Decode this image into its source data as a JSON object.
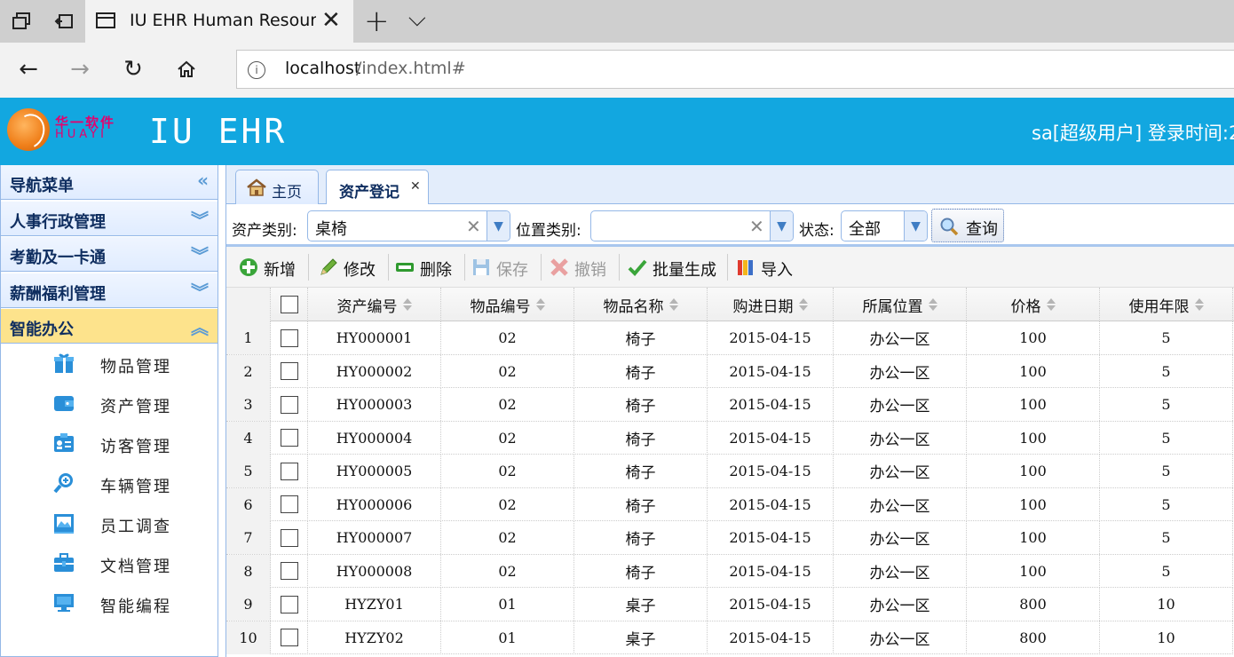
{
  "browser": {
    "tab_title": "IU EHR Human Resource",
    "address_host": "localhost",
    "address_path": "/index.html#"
  },
  "header": {
    "logo_cn": "华一软件",
    "logo_en": "HUAYI",
    "app_title": "IU EHR",
    "user_info": "sa[超级用户] 登录时间:2"
  },
  "sidebar": {
    "nav_title": "导航菜单",
    "sections": [
      {
        "label": "人事行政管理"
      },
      {
        "label": "考勤及一卡通"
      },
      {
        "label": "薪酬福利管理"
      },
      {
        "label": "智能办公"
      }
    ],
    "items": [
      {
        "label": "物品管理",
        "icon": "gift-icon"
      },
      {
        "label": "资产管理",
        "icon": "wallet-icon"
      },
      {
        "label": "访客管理",
        "icon": "id-card-icon"
      },
      {
        "label": "车辆管理",
        "icon": "magnifier-plus-icon"
      },
      {
        "label": "员工调查",
        "icon": "picture-icon"
      },
      {
        "label": "文档管理",
        "icon": "briefcase-icon"
      },
      {
        "label": "智能编程",
        "icon": "monitor-icon"
      }
    ]
  },
  "page_tabs": [
    {
      "label": "主页"
    },
    {
      "label": "资产登记"
    }
  ],
  "query": {
    "asset_type_label": "资产类别:",
    "asset_type_value": "桌椅",
    "location_type_label": "位置类别:",
    "location_type_value": "",
    "status_label": "状态:",
    "status_value": "全部",
    "query_button": "查询"
  },
  "toolbar": {
    "add": "新增",
    "edit": "修改",
    "delete": "删除",
    "save": "保存",
    "undo": "撤销",
    "batch": "批量生成",
    "import": "导入"
  },
  "grid": {
    "columns": [
      "资产编号",
      "物品编号",
      "物品名称",
      "购进日期",
      "所属位置",
      "价格",
      "使用年限"
    ],
    "rows": [
      {
        "n": "1",
        "asset_no": "HY000001",
        "item_no": "02",
        "name": "椅子",
        "date": "2015-04-15",
        "location": "办公一区",
        "price": "100",
        "years": "5"
      },
      {
        "n": "2",
        "asset_no": "HY000002",
        "item_no": "02",
        "name": "椅子",
        "date": "2015-04-15",
        "location": "办公一区",
        "price": "100",
        "years": "5"
      },
      {
        "n": "3",
        "asset_no": "HY000003",
        "item_no": "02",
        "name": "椅子",
        "date": "2015-04-15",
        "location": "办公一区",
        "price": "100",
        "years": "5"
      },
      {
        "n": "4",
        "asset_no": "HY000004",
        "item_no": "02",
        "name": "椅子",
        "date": "2015-04-15",
        "location": "办公一区",
        "price": "100",
        "years": "5"
      },
      {
        "n": "5",
        "asset_no": "HY000005",
        "item_no": "02",
        "name": "椅子",
        "date": "2015-04-15",
        "location": "办公一区",
        "price": "100",
        "years": "5"
      },
      {
        "n": "6",
        "asset_no": "HY000006",
        "item_no": "02",
        "name": "椅子",
        "date": "2015-04-15",
        "location": "办公一区",
        "price": "100",
        "years": "5"
      },
      {
        "n": "7",
        "asset_no": "HY000007",
        "item_no": "02",
        "name": "椅子",
        "date": "2015-04-15",
        "location": "办公一区",
        "price": "100",
        "years": "5"
      },
      {
        "n": "8",
        "asset_no": "HY000008",
        "item_no": "02",
        "name": "椅子",
        "date": "2015-04-15",
        "location": "办公一区",
        "price": "100",
        "years": "5"
      },
      {
        "n": "9",
        "asset_no": "HYZY01",
        "item_no": "01",
        "name": "桌子",
        "date": "2015-04-15",
        "location": "办公一区",
        "price": "800",
        "years": "10"
      },
      {
        "n": "10",
        "asset_no": "HYZY02",
        "item_no": "01",
        "name": "桌子",
        "date": "2015-04-15",
        "location": "办公一区",
        "price": "800",
        "years": "10"
      }
    ]
  },
  "colors": {
    "header_blue": "#12a7e0",
    "panel_border": "#95b8e7",
    "selected_section": "#fde38c"
  }
}
